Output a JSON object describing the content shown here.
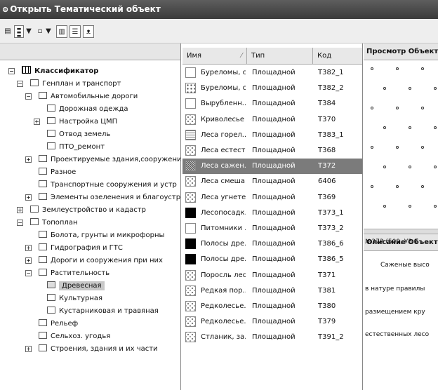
{
  "window": {
    "title": "Открыть Тематический объект",
    "title_icon": "app-icon"
  },
  "toolbar": {
    "icons": [
      "list-view-icon",
      "dropdown-arrow-icon",
      "small-square-icon",
      "dropdown-arrow-icon",
      "grid-view-icon",
      "details-view-icon",
      "binoculars-icon"
    ]
  },
  "tree": [
    {
      "label": "Классификатор",
      "expander": "−"
    },
    {
      "label": "Генплан и транспорт",
      "expander": "−"
    },
    {
      "label": "Автомобильные дороги",
      "expander": "−"
    },
    {
      "label": "Дорожная одежда",
      "expander": ""
    },
    {
      "label": "Настройка ЦМП",
      "expander": "+"
    },
    {
      "label": "Отвод земель",
      "expander": ""
    },
    {
      "label": "ПТО_ремонт",
      "expander": ""
    },
    {
      "label": "Проектируемые здания,сооружени",
      "expander": "+"
    },
    {
      "label": "Разное",
      "expander": ""
    },
    {
      "label": "Транспортные сооружения и устр",
      "expander": ""
    },
    {
      "label": "Элементы озеленения и благоустр",
      "expander": "+"
    },
    {
      "label": "Землеустройство и кадастр",
      "expander": "+"
    },
    {
      "label": "Топоплан",
      "expander": "−"
    },
    {
      "label": "Болота, грунты и микрофорны",
      "expander": ""
    },
    {
      "label": "Гидрография и ГТС",
      "expander": "+"
    },
    {
      "label": "Дороги и сооружения при них",
      "expander": "+"
    },
    {
      "label": "Растительность",
      "expander": "−"
    },
    {
      "label": "Древесная",
      "expander": ""
    },
    {
      "label": "Культурная",
      "expander": ""
    },
    {
      "label": "Кустарниковая и травяная",
      "expander": ""
    },
    {
      "label": "Рельеф",
      "expander": ""
    },
    {
      "label": "Сельхоз. угодья",
      "expander": ""
    },
    {
      "label": "Строения, здания и их части",
      "expander": "+"
    }
  ],
  "list": {
    "columns": {
      "name": "Имя",
      "type": "Тип",
      "code": "Код"
    },
    "rows": [
      {
        "name": "Буреломы, с...",
        "type": "Площадной",
        "code": "Т382_1",
        "symbol": "white"
      },
      {
        "name": "Буреломы, с...",
        "type": "Площадной",
        "code": "Т382_2",
        "symbol": "dots"
      },
      {
        "name": "Вырубленн...",
        "type": "Площадной",
        "code": "Т384",
        "symbol": "white"
      },
      {
        "name": "Криволесье",
        "type": "Площадной",
        "code": "Т370",
        "symbol": "scatter"
      },
      {
        "name": "Леса горел...",
        "type": "Площадной",
        "code": "Т383_1",
        "symbol": "grid"
      },
      {
        "name": "Леса естест...",
        "type": "Площадной",
        "code": "Т368",
        "symbol": "scatter"
      },
      {
        "name": "Леса сажен...",
        "type": "Площадной",
        "code": "Т372",
        "symbol": "dense"
      },
      {
        "name": "Леса смеша...",
        "type": "Площадной",
        "code": "6406",
        "symbol": "scatter"
      },
      {
        "name": "Леса угнете...",
        "type": "Площадной",
        "code": "Т369",
        "symbol": "scatter"
      },
      {
        "name": "Лесопосадк...",
        "type": "Площадной",
        "code": "Т373_1",
        "symbol": "black"
      },
      {
        "name": "Питомники ...",
        "type": "Площадной",
        "code": "Т373_2",
        "symbol": "white"
      },
      {
        "name": "Полосы дре...",
        "type": "Площадной",
        "code": "Т386_6",
        "symbol": "black"
      },
      {
        "name": "Полосы дре...",
        "type": "Площадной",
        "code": "Т386_5",
        "symbol": "black"
      },
      {
        "name": "Поросль леса",
        "type": "Площадной",
        "code": "Т371",
        "symbol": "scatter"
      },
      {
        "name": "Редкая пор...",
        "type": "Площадной",
        "code": "Т381",
        "symbol": "scatter"
      },
      {
        "name": "Редколесье...",
        "type": "Площадной",
        "code": "Т380",
        "symbol": "scatter"
      },
      {
        "name": "Редколесье...",
        "type": "Площадной",
        "code": "Т379",
        "symbol": "scatter"
      },
      {
        "name": "Стланик, за...",
        "type": "Площадной",
        "code": "Т391_2",
        "symbol": "scatter"
      }
    ]
  },
  "preview": {
    "title": "Просмотр Объект"
  },
  "description": {
    "title": "Описание Объекта",
    "lines": [
      "№372 (509, УЗ 1",
      "Саженые высо",
      "в натуре правилы",
      "размещением кру",
      "естественных лесо"
    ]
  }
}
